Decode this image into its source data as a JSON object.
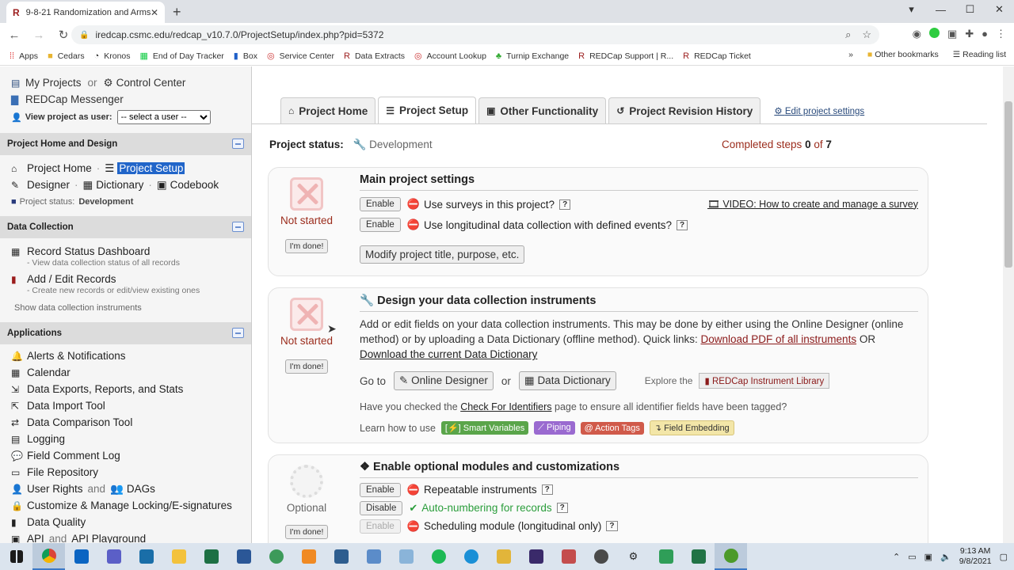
{
  "browser": {
    "tab_title": "9-8-21 Randomization and Arms",
    "url": "iredcap.csmc.edu/redcap_v10.7.0/ProjectSetup/index.php?pid=5372",
    "bookmarks": [
      "Apps",
      "Cedars",
      "Kronos",
      "End of Day Tracker",
      "Box",
      "Service Center",
      "Data Extracts",
      "Account Lookup",
      "Turnip Exchange",
      "REDCap Support | R...",
      "REDCap Ticket"
    ],
    "bookmarks_more": "»",
    "other_bookmarks": "Other bookmarks",
    "reading_list": "Reading list"
  },
  "sidebar": {
    "my_projects": "My Projects",
    "or": "or",
    "control_center": "Control Center",
    "messenger": "REDCap Messenger",
    "view_as_label": "View project as user:",
    "view_as_placeholder": "-- select a user --",
    "sections": {
      "home_design": {
        "title": "Project Home and Design",
        "project_home": "Project Home",
        "project_setup": "Project Setup",
        "designer": "Designer",
        "dictionary": "Dictionary",
        "codebook": "Codebook",
        "status_label": "Project status:",
        "status_value": "Development"
      },
      "data_collection": {
        "title": "Data Collection",
        "record_status": "Record Status Dashboard",
        "record_status_sub": "- View data collection status of all records",
        "add_edit": "Add / Edit Records",
        "add_edit_sub": "- Create new records or edit/view existing ones",
        "show_instruments": "Show data collection instruments"
      },
      "applications": {
        "title": "Applications",
        "items": [
          "Alerts & Notifications",
          "Calendar",
          "Data Exports, Reports, and Stats",
          "Data Import Tool",
          "Data Comparison Tool",
          "Logging",
          "Field Comment Log",
          "File Repository",
          "User Rights",
          "Customize & Manage Locking/E-signatures",
          "Data Quality",
          "API"
        ],
        "and": "and",
        "dags": "DAGs",
        "api_and": "and",
        "api_playground": "API Playground"
      }
    }
  },
  "main": {
    "tabs": [
      "Project Home",
      "Project Setup",
      "Other Functionality",
      "Project Revision History"
    ],
    "edit_settings": "Edit project settings",
    "status_label": "Project status:",
    "status_value": "Development",
    "completed_prefix": "Completed steps",
    "completed_done": "0",
    "completed_of": "of",
    "completed_total": "7",
    "cards": {
      "main_settings": {
        "title": "Main project settings",
        "state": "Not started",
        "done": "I'm done!",
        "enable": "Enable",
        "opt1": "Use surveys in this project?",
        "opt2": "Use longitudinal data collection with defined events?",
        "q": "?",
        "video": "VIDEO: How to create and manage a survey",
        "modify": "Modify project title, purpose, etc."
      },
      "design": {
        "title": "Design your data collection instruments",
        "state": "Not started",
        "done": "I'm done!",
        "text": "Add or edit fields on your data collection instruments. This may be done by either using the Online Designer (online method) or by uploading a Data Dictionary (offline method). Quick links:",
        "link_pdf": "Download PDF of all instruments",
        "or": "OR",
        "link_dd": "Download the current Data Dictionary",
        "goto": "Go to",
        "online_designer": "Online Designer",
        "or2": "or",
        "data_dictionary": "Data Dictionary",
        "explore": "Explore the",
        "library": "REDCap Instrument Library",
        "check_pre": "Have you checked the",
        "check_link": "Check For Identifiers",
        "check_post": "page to ensure all identifier fields have been tagged?",
        "learn": "Learn how to use",
        "tags": [
          "Smart Variables",
          "Piping",
          "@ Action Tags",
          "Field Embedding"
        ]
      },
      "optional": {
        "title": "Enable optional modules and customizations",
        "state": "Optional",
        "done": "I'm done!",
        "rows": [
          {
            "btn": "Enable",
            "label": "Repeatable instruments",
            "status": "off"
          },
          {
            "btn": "Disable",
            "label": "Auto-numbering for records",
            "status": "on"
          },
          {
            "btn": "Enable",
            "label": "Scheduling module (longitudinal only)",
            "status": "off"
          }
        ],
        "q": "?"
      }
    }
  },
  "taskbar": {
    "time": "9:13 AM",
    "date": "9/8/2021"
  },
  "colors": {
    "accent": "#2165c9",
    "danger": "#c82333",
    "success": "#2a9d3b",
    "redcap": "#8b1a1a"
  }
}
